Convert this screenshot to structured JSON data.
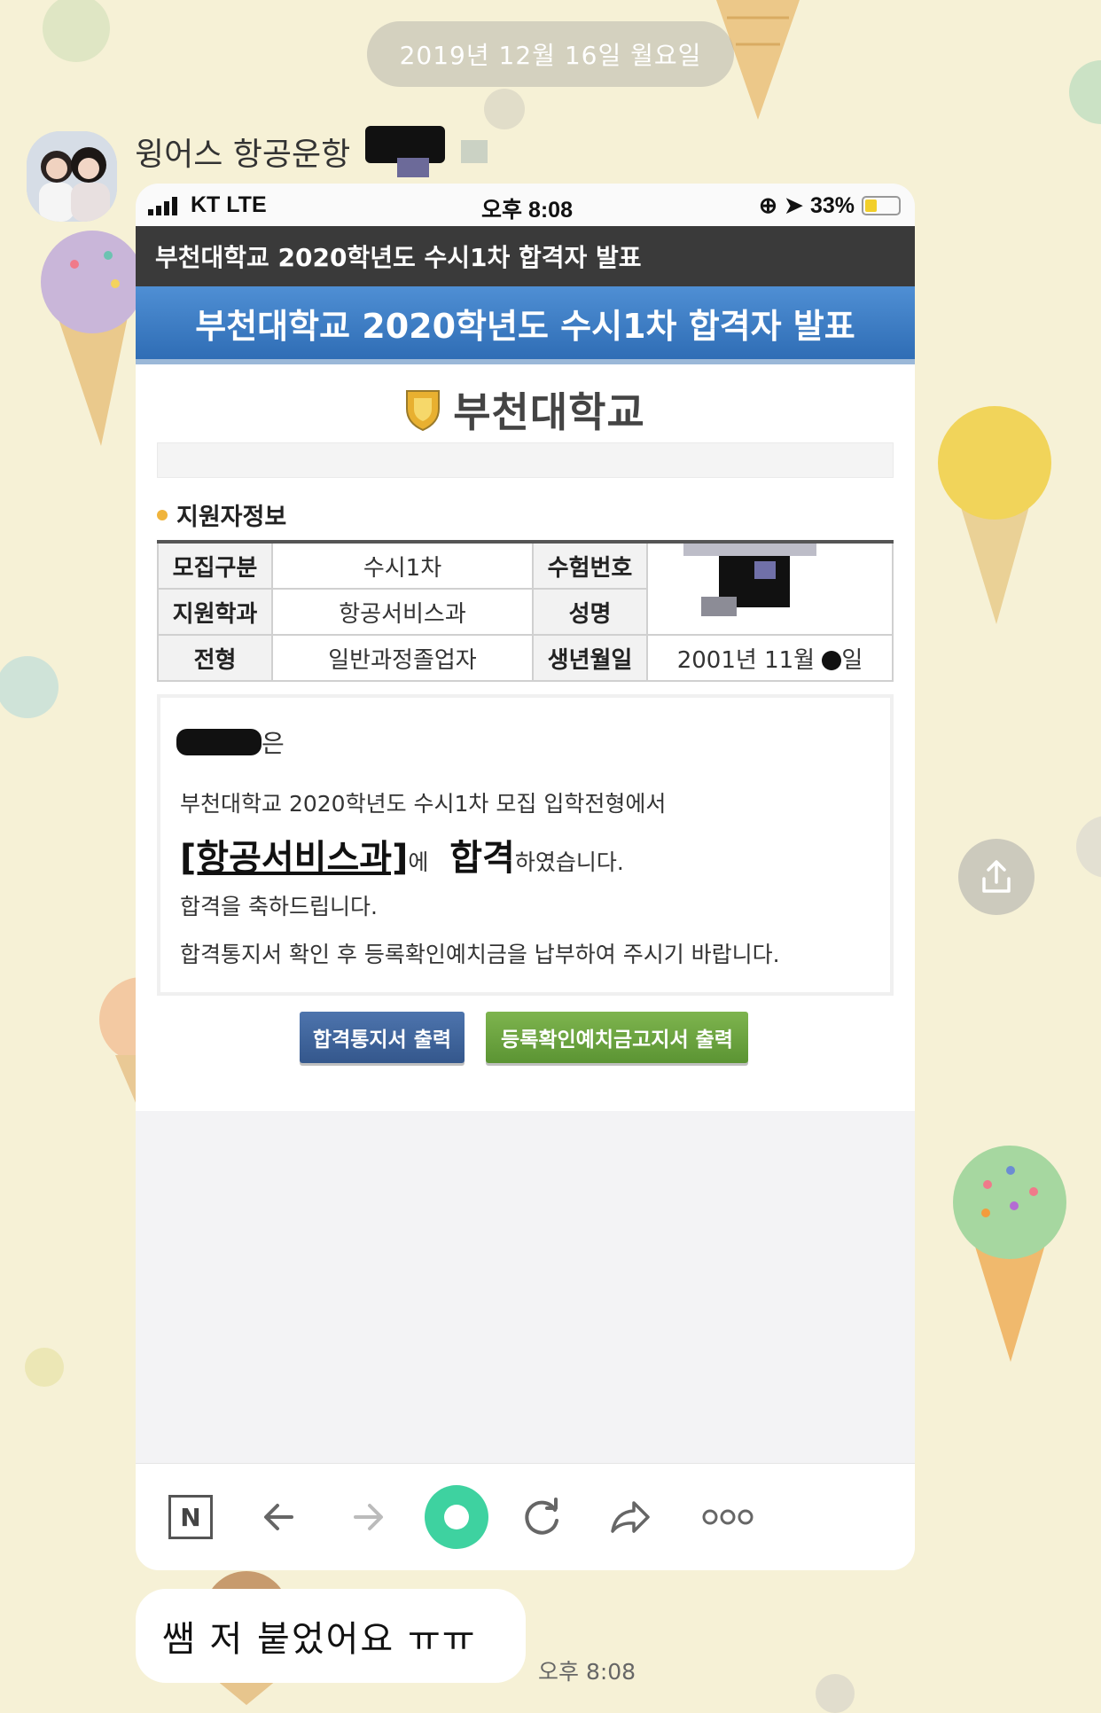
{
  "chat": {
    "date_separator": "2019년 12월 16일 월요일",
    "sender_name": "윙어스 항공운항 ",
    "message_text": "쌤 저 붙었어요 ㅠㅠ",
    "message_time": "오후 8:08"
  },
  "screenshot": {
    "status_bar": {
      "carrier": "KT LTE",
      "time": "오후 8:08",
      "battery": "33%",
      "battery_level": 0.33
    },
    "page_title_bar": "부천대학교 2020학년도 수시1차 합격자 발표",
    "banner_title": "부천대학교 2020학년도 수시1차 합격자 발표",
    "logo_text": "부천대학교",
    "section_title": "지원자정보",
    "info_table": [
      {
        "label1": "모집구분",
        "value1": "수시1차",
        "label2": "수험번호",
        "value2": ""
      },
      {
        "label1": "지원학과",
        "value1": "항공서비스과",
        "label2": "성명",
        "value2": ""
      },
      {
        "label1": "전형",
        "value1": "일반과정졸업자",
        "label2": "생년월일",
        "value2": "2001년 11월 ",
        "value2_tail": "일"
      }
    ],
    "result": {
      "name_suffix": "은",
      "line1": "부천대학교 2020학년도 수시1차 모집 입학전형에서",
      "dept": "[항공서비스과]",
      "dept_particle": "에",
      "pass_word": "합격",
      "pass_tail": "하였습니다.",
      "congrats": "합격을 축하드립니다.",
      "notice": "합격통지서 확인 후 등록확인예치금을 납부하여 주시기 바랍니다."
    },
    "buttons": {
      "print_notice": "합격통지서 출력",
      "print_deposit": "등록확인예치금고지서 출력"
    },
    "browser_toolbar": {
      "naver_label": "N"
    }
  },
  "colors": {
    "wallpaper": "#f6f1d6",
    "banner_blue": "#2f6db5",
    "button_blue": "#34578c",
    "button_green": "#5b9433",
    "naver_green": "#3ed2a0"
  }
}
